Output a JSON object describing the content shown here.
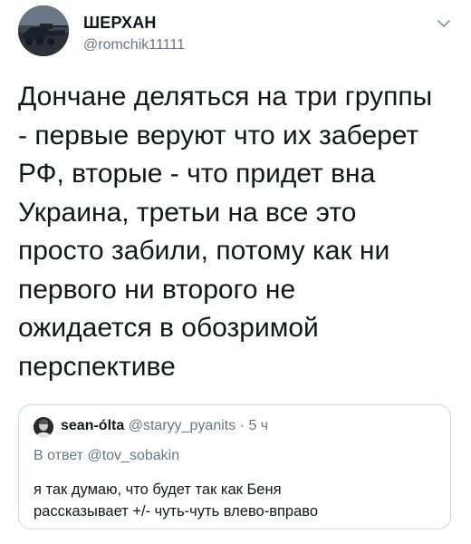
{
  "author": {
    "display_name": "ШЕРХАН",
    "handle": "@romchik11111",
    "avatar": "avatar-photo"
  },
  "menu": {
    "icon": "chevron-down-icon"
  },
  "tweet": {
    "text_lines": [
      "Дончане деляться на три группы",
      "- первые веруют что их заберет",
      "РФ, вторые - что придет вна",
      "Украина, третьи на все это",
      "просто забили, потому как ни",
      "первого ни второго не",
      "ожидается в обозримой",
      "перспективе"
    ]
  },
  "quoted_tweet": {
    "display_name": "sean-ólta",
    "handle": "@staryy_pyanits",
    "separator": "·",
    "time": "5 ч",
    "reply_to": "В ответ @tov_sobakin",
    "text_lines": [
      "я так думаю, что будет так как Беня",
      "рассказывает +/- чуть-чуть влево-вправо"
    ],
    "avatar": "avatar-photo"
  },
  "colors": {
    "text_primary": "#14171a",
    "text_secondary": "#657786",
    "border": "#ccd6dd"
  }
}
